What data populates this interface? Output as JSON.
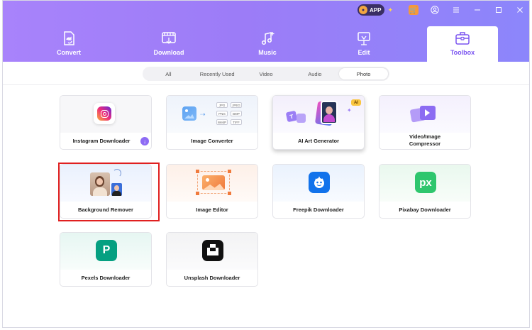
{
  "titlebar": {
    "app_badge": "APP",
    "icons": [
      "cart-icon",
      "user-icon",
      "menu-icon",
      "minimize-icon",
      "maximize-icon",
      "close-icon"
    ]
  },
  "tabs": [
    {
      "label": "Convert",
      "icon": "convert-icon"
    },
    {
      "label": "Download",
      "icon": "download-icon"
    },
    {
      "label": "Music",
      "icon": "music-icon"
    },
    {
      "label": "Edit",
      "icon": "edit-icon"
    },
    {
      "label": "Toolbox",
      "icon": "toolbox-icon",
      "active": true
    }
  ],
  "filters": [
    "All",
    "Recently Used",
    "Video",
    "Audio",
    "Photo"
  ],
  "active_filter": "Photo",
  "cards": [
    {
      "title": "Instagram Downloader"
    },
    {
      "title": "Image Converter",
      "formats": [
        "JPG",
        "JPEG",
        "PNG",
        "BMP",
        "WebP",
        "TIFF"
      ]
    },
    {
      "title": "AI Art Generator",
      "badge": "AI"
    },
    {
      "title": "Video/Image Compressor"
    },
    {
      "title": "Background Remover"
    },
    {
      "title": "Image Editor"
    },
    {
      "title": "Freepik Downloader"
    },
    {
      "title": "Pixabay Downloader",
      "logo": "px"
    },
    {
      "title": "Pexels Downloader",
      "logo": "P"
    },
    {
      "title": "Unsplash Downloader"
    }
  ],
  "colors": {
    "accent": "#7b55f0",
    "header_start": "#a883fb",
    "header_end": "#8c86fb",
    "highlight": "#e02020",
    "freepik": "#1273eb",
    "pixabay": "#2ec66d",
    "pexels": "#05a081",
    "unsplash": "#111111"
  }
}
